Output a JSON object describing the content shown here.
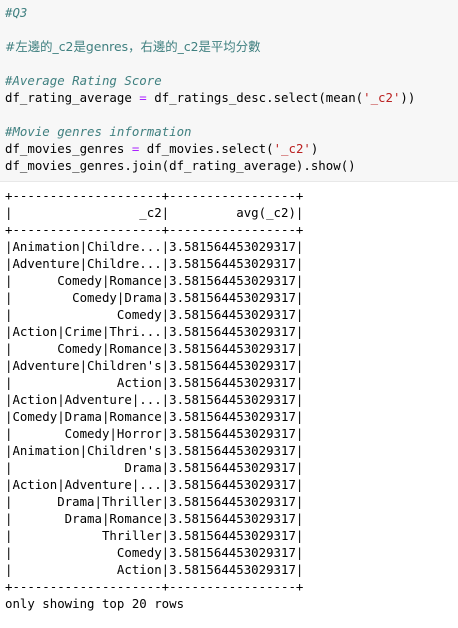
{
  "input": {
    "q_comment": "#Q3",
    "desc_comment": "#左邊的_c2是genres，右邊的_c2是平均分數",
    "avg_comment": "#Average Rating Score",
    "avg_lhs": "df_rating_average",
    "avg_eq": "=",
    "avg_call_a": "df_ratings_desc.select(mean(",
    "avg_str": "'_c2'",
    "avg_call_b": "))",
    "movie_comment": "#Movie genres information",
    "movies_lhs": "df_movies_genres",
    "movies_eq": "=",
    "movies_call_a": "df_movies.select(",
    "movies_str": "'_c2'",
    "movies_call_b": ")",
    "join_line": "df_movies_genres.join(df_rating_average).show()"
  },
  "output": {
    "border": "+--------------------+-----------------+",
    "header": "|                 _c2|         avg(_c2)|",
    "rows": [
      "|Animation|Childre...|3.581564453029317|",
      "|Adventure|Childre...|3.581564453029317|",
      "|      Comedy|Romance|3.581564453029317|",
      "|        Comedy|Drama|3.581564453029317|",
      "|              Comedy|3.581564453029317|",
      "|Action|Crime|Thri...|3.581564453029317|",
      "|      Comedy|Romance|3.581564453029317|",
      "|Adventure|Children's|3.581564453029317|",
      "|              Action|3.581564453029317|",
      "|Action|Adventure|...|3.581564453029317|",
      "|Comedy|Drama|Romance|3.581564453029317|",
      "|       Comedy|Horror|3.581564453029317|",
      "|Animation|Children's|3.581564453029317|",
      "|               Drama|3.581564453029317|",
      "|Action|Adventure|...|3.581564453029317|",
      "|      Drama|Thriller|3.581564453029317|",
      "|       Drama|Romance|3.581564453029317|",
      "|            Thriller|3.581564453029317|",
      "|              Comedy|3.581564453029317|",
      "|              Action|3.581564453029317|"
    ],
    "footer": "only showing top 20 rows"
  }
}
